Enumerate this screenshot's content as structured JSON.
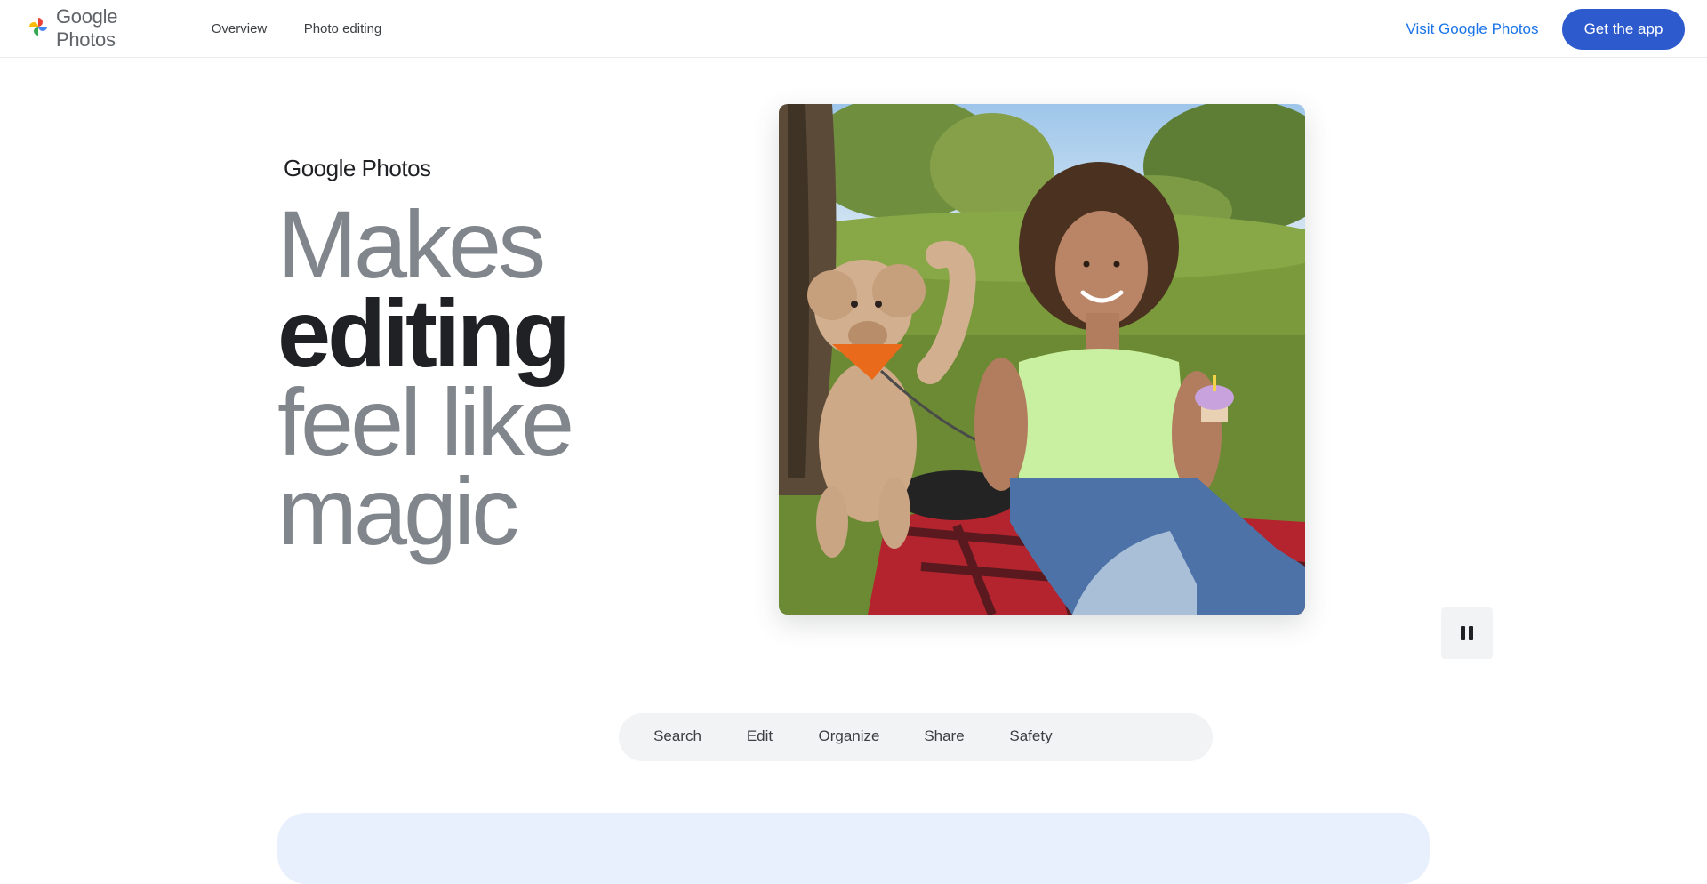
{
  "header": {
    "logo": {
      "brand": "Google Photos"
    },
    "nav": [
      {
        "label": "Overview"
      },
      {
        "label": "Photo editing"
      }
    ],
    "visit_button": "Visit Google Photos",
    "get_app_button": "Get the app"
  },
  "hero": {
    "brand_google": "Google",
    "brand_photos": "Photos",
    "headline": {
      "line1": "Makes",
      "line2": "editing",
      "line3": "feel like",
      "line4": "magic"
    }
  },
  "media": {
    "play_state": "paused",
    "control_icon": "pause-icon"
  },
  "sections": {
    "tabs": [
      {
        "label": "Search"
      },
      {
        "label": "Edit"
      },
      {
        "label": "Organize"
      },
      {
        "label": "Share"
      },
      {
        "label": "Safety"
      }
    ],
    "download_label": ""
  },
  "colors": {
    "primary_button": "#2d5bce",
    "link_blue": "#1a73e8",
    "headline_grey": "#80868b",
    "headline_dark": "#202124",
    "pill_bg": "#f1f3f4",
    "card_bg": "#e8f0fe"
  }
}
